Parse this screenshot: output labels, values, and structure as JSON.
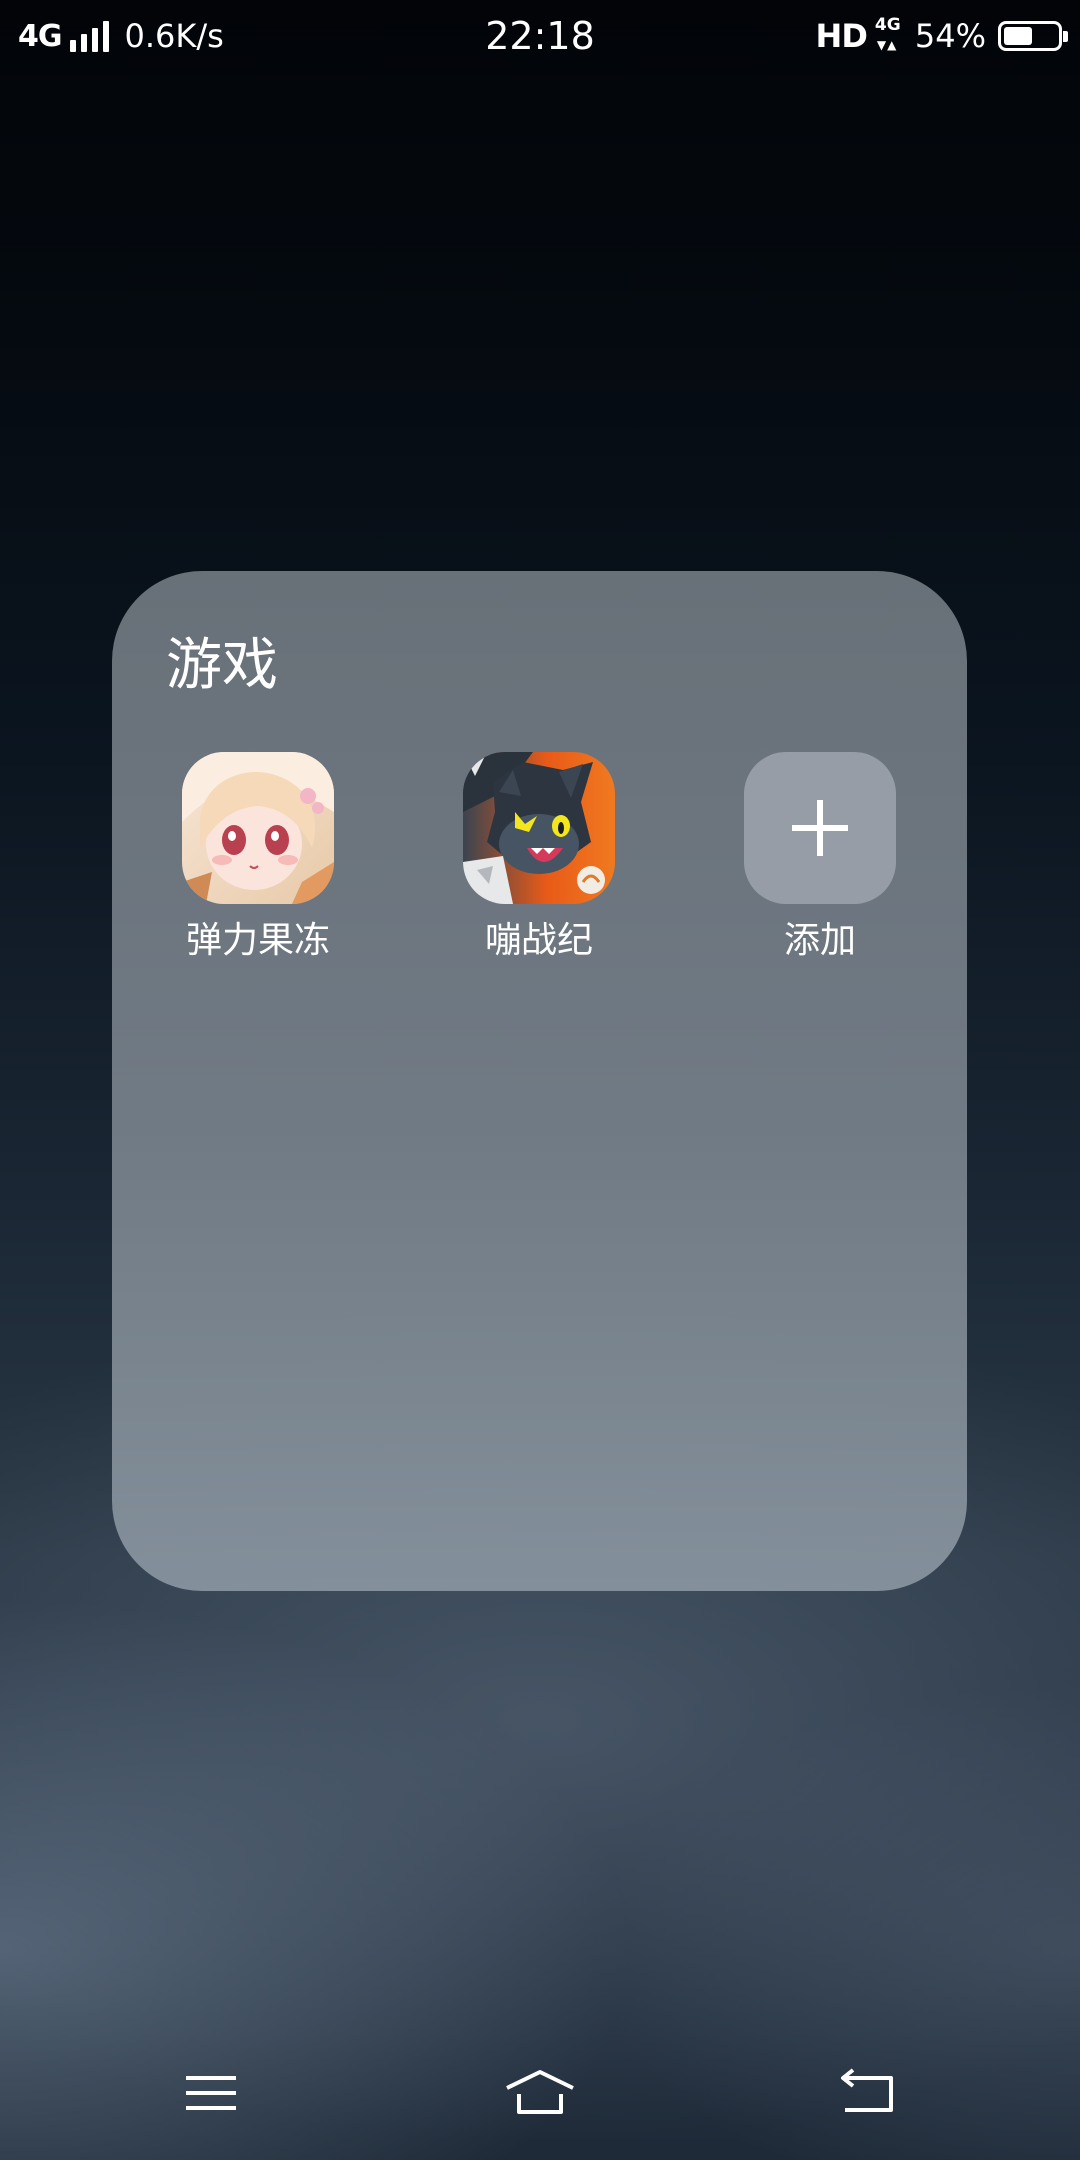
{
  "status_bar": {
    "network": "4G",
    "speed": "0.6K/s",
    "time": "22:18",
    "hd": "HD",
    "net_small": "4G",
    "battery_percent": "54%",
    "battery_level": 0.54,
    "signal_bars": 4
  },
  "folder": {
    "title": "游戏",
    "apps": [
      {
        "label": "弹力果冻",
        "icon": "anime-girl-app-icon"
      },
      {
        "label": "嘣战纪",
        "icon": "anime-cat-app-icon"
      },
      {
        "label": "添加",
        "icon": "plus-icon"
      }
    ]
  },
  "nav_bar": {
    "menu_icon": "menu-icon",
    "home_icon": "home-icon",
    "back_icon": "back-icon"
  },
  "colors": {
    "folder_bg": "#6c747c",
    "add_tile": "#a5abb4",
    "text": "#ffffff"
  }
}
